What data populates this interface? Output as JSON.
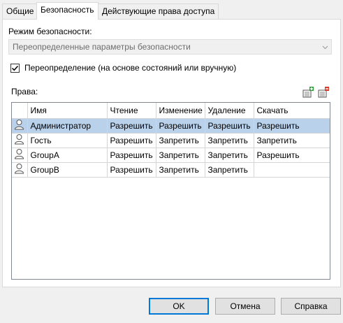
{
  "tabs": [
    {
      "label": "Общие",
      "active": false
    },
    {
      "label": "Безопасность",
      "active": true
    },
    {
      "label": "Действующие права доступа",
      "active": false
    }
  ],
  "security_mode": {
    "label": "Режим безопасности:",
    "selected_value": "Переопределенные параметры безопасности"
  },
  "override": {
    "label": "Переопределение (на основе состояний или вручную)",
    "checked": true
  },
  "rights": {
    "label": "Права:",
    "toolbar": [
      "add-entry-icon",
      "remove-entry-icon"
    ],
    "columns": [
      "Имя",
      "Чтение",
      "Изменение",
      "Удаление",
      "Скачать"
    ],
    "rows": [
      {
        "name": "Администратор",
        "read": "Разрешить",
        "change": "Разрешить",
        "delete": "Разрешить",
        "download": "Разрешить",
        "selected": true
      },
      {
        "name": "Гость",
        "read": "Разрешить",
        "change": "Запретить",
        "delete": "Запретить",
        "download": "Запретить",
        "selected": false
      },
      {
        "name": "GroupA",
        "read": "Разрешить",
        "change": "Запретить",
        "delete": "Запретить",
        "download": "Разрешить",
        "selected": false
      },
      {
        "name": "GroupB",
        "read": "Разрешить",
        "change": "Запретить",
        "delete": "Запретить",
        "download": "",
        "selected": false
      }
    ]
  },
  "buttons": {
    "ok": "OK",
    "cancel": "Отмена",
    "help": "Справка"
  },
  "colors": {
    "selection": "#b9d1ea",
    "default_button_border": "#0078d7"
  }
}
